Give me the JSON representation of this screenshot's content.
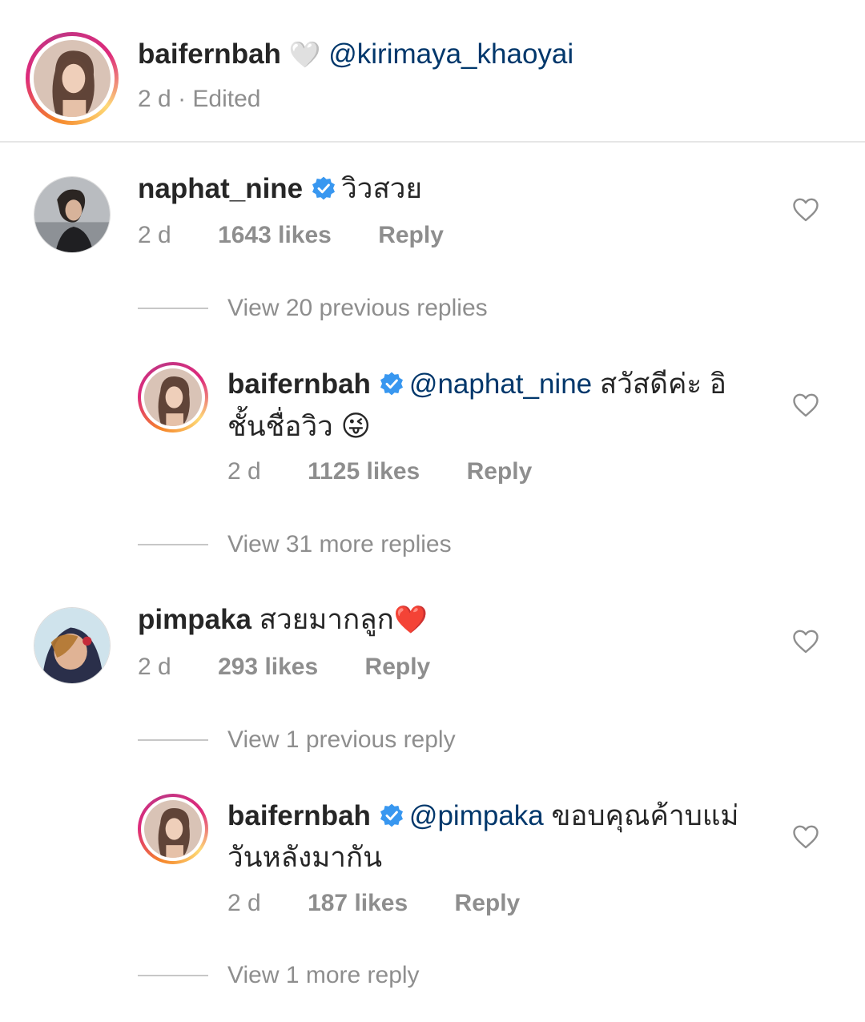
{
  "caption": {
    "username": "baifernbah",
    "heart_emoji": "🤍",
    "mention": "@kirimaya_khaoyai",
    "time": "2 d",
    "edited": "· Edited"
  },
  "comments": [
    {
      "username": "naphat_nine",
      "verified": true,
      "text": "วิวสวย",
      "time": "2 d",
      "likes": "1643 likes",
      "reply": "Reply",
      "view_replies": "View 20 previous replies",
      "reply_item": {
        "username": "baifernbah",
        "verified": true,
        "mention": "@naphat_nine",
        "text_line1": "สวัสดีค่ะ อิ",
        "text_line2": "ชั้นชื่อวิว",
        "emoji": "😜",
        "time": "2 d",
        "likes": "1125 likes",
        "reply": "Reply"
      },
      "view_more": "View 31 more replies"
    },
    {
      "username": "pimpaka",
      "verified": false,
      "text": "สวยมากลูก",
      "emoji": "❤️",
      "time": "2 d",
      "likes": "293 likes",
      "reply": "Reply",
      "view_replies": "View 1 previous reply",
      "reply_item": {
        "username": "baifernbah",
        "verified": true,
        "mention": "@pimpaka",
        "text_line1": "ขอบคุณค้าบแม่",
        "text_line2": "วันหลังมากัน",
        "time": "2 d",
        "likes": "187 likes",
        "reply": "Reply"
      },
      "view_more": "View 1 more reply"
    }
  ],
  "colors": {
    "username": "#262626",
    "mention": "#00376b",
    "meta": "#8e8e8e",
    "verified": "#3897f0",
    "heart_red": "#ed1c3a"
  },
  "icons": [
    "verified-badge-icon",
    "heart-outline-icon",
    "white-heart-emoji",
    "winking-tongue-emoji",
    "red-heart-emoji"
  ]
}
